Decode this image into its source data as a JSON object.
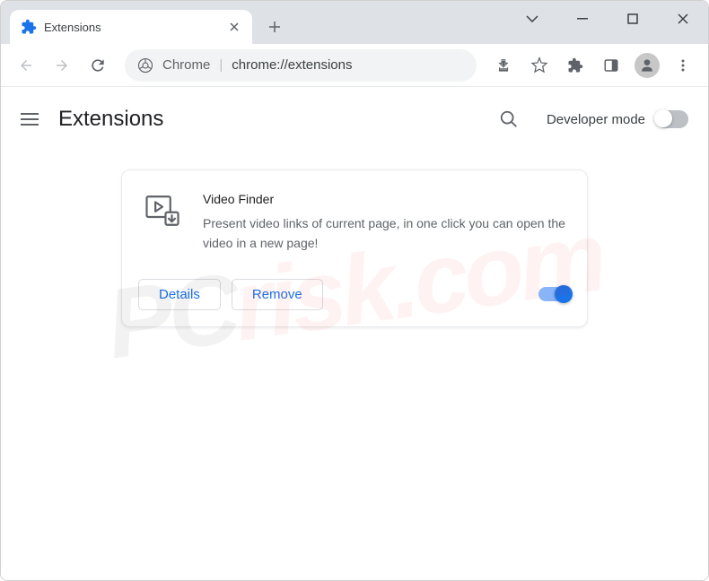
{
  "browser": {
    "tab_title": "Extensions",
    "omnibox_label": "Chrome",
    "omnibox_url": "chrome://extensions"
  },
  "page": {
    "title": "Extensions",
    "dev_mode_label": "Developer mode",
    "dev_mode_enabled": false
  },
  "extension": {
    "name": "Video Finder",
    "description": "Present video links of current page, in one click you can open the video in a new page!",
    "details_label": "Details",
    "remove_label": "Remove",
    "enabled": true
  },
  "watermark": {
    "text_prefix": "PC",
    "text_suffix": "risk.com"
  }
}
